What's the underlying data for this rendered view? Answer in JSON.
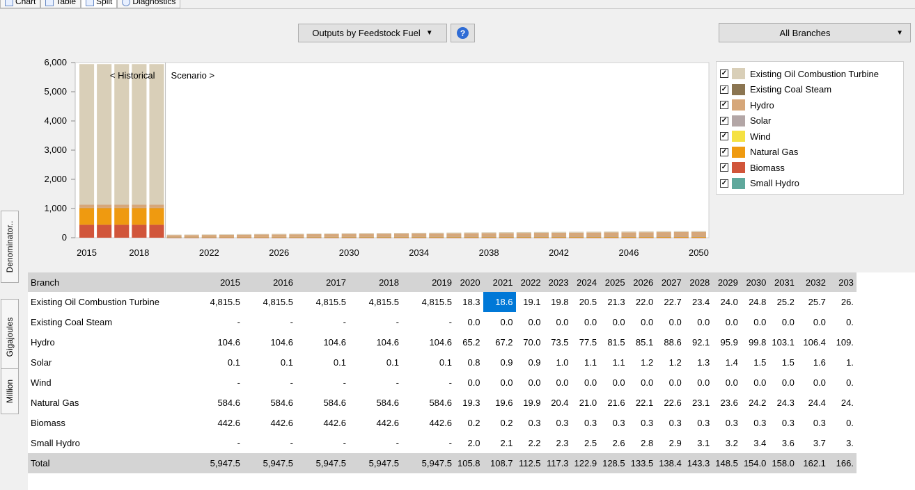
{
  "tabs": [
    {
      "label": "Chart",
      "active": false
    },
    {
      "label": "Table",
      "active": false
    },
    {
      "label": "Split",
      "active": true
    },
    {
      "label": "Diagnostics",
      "active": false
    }
  ],
  "toolbar": {
    "outputs_selector": "Outputs by Feedstock Fuel",
    "branches_selector": "All Branches"
  },
  "side_tabs": [
    "Denominator..",
    "Gigajoules",
    "Million"
  ],
  "legend": [
    {
      "label": "Existing Oil Combustion Turbine",
      "color": "#d9cfb8",
      "checked": true
    },
    {
      "label": "Existing Coal Steam",
      "color": "#8b7551",
      "checked": true
    },
    {
      "label": "Hydro",
      "color": "#d6a77a",
      "checked": true
    },
    {
      "label": "Solar",
      "color": "#b3a6a6",
      "checked": true
    },
    {
      "label": "Wind",
      "color": "#f5e142",
      "checked": true
    },
    {
      "label": "Natural Gas",
      "color": "#ef9a10",
      "checked": true
    },
    {
      "label": "Biomass",
      "color": "#d1553a",
      "checked": true
    },
    {
      "label": "Small Hydro",
      "color": "#5fa89c",
      "checked": true
    }
  ],
  "chart_data": {
    "type": "bar",
    "stacked": true,
    "x": [
      2015,
      2016,
      2017,
      2018,
      2019,
      2020,
      2021,
      2022,
      2023,
      2024,
      2025,
      2026,
      2027,
      2028,
      2029,
      2030,
      2031,
      2032,
      2033,
      2034,
      2035,
      2036,
      2037,
      2038,
      2039,
      2040,
      2041,
      2042,
      2043,
      2044,
      2045,
      2046,
      2047,
      2048,
      2049,
      2050
    ],
    "x_ticks": [
      "2015",
      "2018",
      "2022",
      "2026",
      "2030",
      "2034",
      "2038",
      "2042",
      "2046",
      "2050"
    ],
    "y_ticks": [
      "6,000",
      "5,000",
      "4,000",
      "3,000",
      "2,000",
      "1,000",
      "0"
    ],
    "ylim": [
      0,
      6000
    ],
    "annotations": [
      "< Historical",
      "Scenario >"
    ],
    "series": [
      {
        "name": "Biomass",
        "color": "#d1553a",
        "values": [
          442.6,
          442.6,
          442.6,
          442.6,
          442.6,
          0.2,
          0.2,
          0.3,
          0.3,
          0.3,
          0.3,
          0.3,
          0.3,
          0.3,
          0.3,
          0.3,
          0.3,
          0.3,
          0.3,
          0.3,
          0.3,
          0.3,
          0.3,
          0.3,
          0.3,
          0.3,
          0.3,
          0.3,
          0.3,
          0.3,
          0.3,
          0.3,
          0.3,
          0.3,
          0.3,
          0.3
        ]
      },
      {
        "name": "Natural Gas",
        "color": "#ef9a10",
        "values": [
          584.6,
          584.6,
          584.6,
          584.6,
          584.6,
          19.3,
          19.6,
          19.9,
          20.4,
          21.0,
          21.6,
          22.1,
          22.6,
          23.1,
          23.6,
          24.2,
          24.3,
          24.4,
          24.5,
          24.6,
          24.7,
          24.8,
          24.9,
          25.0,
          25.1,
          25.2,
          25.3,
          25.4,
          25.5,
          25.6,
          25.7,
          25.8,
          25.9,
          26.0,
          26.1,
          26.2
        ]
      },
      {
        "name": "Small Hydro",
        "color": "#5fa89c",
        "values": [
          0,
          0,
          0,
          0,
          0,
          2.0,
          2.1,
          2.2,
          2.3,
          2.5,
          2.6,
          2.8,
          2.9,
          3.1,
          3.2,
          3.4,
          3.6,
          3.7,
          3.9,
          4.0,
          4.2,
          4.3,
          4.5,
          4.6,
          4.8,
          4.9,
          5.1,
          5.2,
          5.4,
          5.5,
          5.7,
          5.8,
          6.0,
          6.1,
          6.3,
          6.4
        ]
      },
      {
        "name": "Solar",
        "color": "#b3a6a6",
        "values": [
          0.1,
          0.1,
          0.1,
          0.1,
          0.1,
          0.8,
          0.9,
          0.9,
          1.0,
          1.1,
          1.1,
          1.2,
          1.2,
          1.3,
          1.4,
          1.5,
          1.5,
          1.6,
          1.7,
          1.7,
          1.8,
          1.9,
          2.0,
          2.0,
          2.1,
          2.2,
          2.3,
          2.3,
          2.4,
          2.5,
          2.6,
          2.6,
          2.7,
          2.8,
          2.9,
          3.0
        ]
      },
      {
        "name": "Hydro",
        "color": "#d6a77a",
        "values": [
          104.6,
          104.6,
          104.6,
          104.6,
          104.6,
          65.2,
          67.2,
          70.0,
          73.5,
          77.5,
          81.5,
          85.1,
          88.6,
          92.1,
          95.9,
          99.8,
          103.1,
          106.4,
          109.5,
          112,
          115,
          118,
          121,
          124,
          127,
          130,
          133,
          136,
          139,
          142,
          145,
          148,
          151,
          154,
          157,
          160
        ]
      },
      {
        "name": "Existing Coal Steam",
        "color": "#8b7551",
        "values": [
          0,
          0,
          0,
          0,
          0,
          0,
          0,
          0,
          0,
          0,
          0,
          0,
          0,
          0,
          0,
          0,
          0,
          0,
          0,
          0,
          0,
          0,
          0,
          0,
          0,
          0,
          0,
          0,
          0,
          0,
          0,
          0,
          0,
          0,
          0,
          0
        ]
      },
      {
        "name": "Wind",
        "color": "#f5e142",
        "values": [
          0,
          0,
          0,
          0,
          0,
          0,
          0,
          0,
          0,
          0,
          0,
          0,
          0,
          0,
          0,
          0,
          0,
          0,
          0,
          0,
          0,
          0,
          0,
          0,
          0,
          0,
          0,
          0,
          0,
          0,
          0,
          0,
          0,
          0,
          0,
          0
        ]
      },
      {
        "name": "Existing Oil Combustion Turbine",
        "color": "#d9cfb8",
        "values": [
          4815.5,
          4815.5,
          4815.5,
          4815.5,
          4815.5,
          18.3,
          18.6,
          19.1,
          19.8,
          20.5,
          21.3,
          22.0,
          22.7,
          23.4,
          24.0,
          24.8,
          25.2,
          25.7,
          26.2,
          26.7,
          27.2,
          27.7,
          28.2,
          28.7,
          29.2,
          29.7,
          30.2,
          30.7,
          31.2,
          31.7,
          32.2,
          32.7,
          33.2,
          33.7,
          34.2,
          34.7
        ]
      }
    ]
  },
  "table": {
    "header_label": "Branch",
    "years": [
      "2015",
      "2016",
      "2017",
      "2018",
      "2019",
      "2020",
      "2021",
      "2022",
      "2023",
      "2024",
      "2025",
      "2026",
      "2027",
      "2028",
      "2029",
      "2030",
      "2031",
      "2032",
      "203"
    ],
    "rows": [
      {
        "name": "Existing Oil Combustion Turbine",
        "values": [
          "4,815.5",
          "4,815.5",
          "4,815.5",
          "4,815.5",
          "4,815.5",
          "18.3",
          "18.6",
          "19.1",
          "19.8",
          "20.5",
          "21.3",
          "22.0",
          "22.7",
          "23.4",
          "24.0",
          "24.8",
          "25.2",
          "25.7",
          "26."
        ]
      },
      {
        "name": "Existing Coal Steam",
        "values": [
          "-",
          "-",
          "-",
          "-",
          "-",
          "0.0",
          "0.0",
          "0.0",
          "0.0",
          "0.0",
          "0.0",
          "0.0",
          "0.0",
          "0.0",
          "0.0",
          "0.0",
          "0.0",
          "0.0",
          "0."
        ]
      },
      {
        "name": "Hydro",
        "values": [
          "104.6",
          "104.6",
          "104.6",
          "104.6",
          "104.6",
          "65.2",
          "67.2",
          "70.0",
          "73.5",
          "77.5",
          "81.5",
          "85.1",
          "88.6",
          "92.1",
          "95.9",
          "99.8",
          "103.1",
          "106.4",
          "109."
        ]
      },
      {
        "name": "Solar",
        "values": [
          "0.1",
          "0.1",
          "0.1",
          "0.1",
          "0.1",
          "0.8",
          "0.9",
          "0.9",
          "1.0",
          "1.1",
          "1.1",
          "1.2",
          "1.2",
          "1.3",
          "1.4",
          "1.5",
          "1.5",
          "1.6",
          "1."
        ]
      },
      {
        "name": "Wind",
        "values": [
          "-",
          "-",
          "-",
          "-",
          "-",
          "0.0",
          "0.0",
          "0.0",
          "0.0",
          "0.0",
          "0.0",
          "0.0",
          "0.0",
          "0.0",
          "0.0",
          "0.0",
          "0.0",
          "0.0",
          "0."
        ]
      },
      {
        "name": "Natural Gas",
        "values": [
          "584.6",
          "584.6",
          "584.6",
          "584.6",
          "584.6",
          "19.3",
          "19.6",
          "19.9",
          "20.4",
          "21.0",
          "21.6",
          "22.1",
          "22.6",
          "23.1",
          "23.6",
          "24.2",
          "24.3",
          "24.4",
          "24."
        ]
      },
      {
        "name": "Biomass",
        "values": [
          "442.6",
          "442.6",
          "442.6",
          "442.6",
          "442.6",
          "0.2",
          "0.2",
          "0.3",
          "0.3",
          "0.3",
          "0.3",
          "0.3",
          "0.3",
          "0.3",
          "0.3",
          "0.3",
          "0.3",
          "0.3",
          "0."
        ]
      },
      {
        "name": "Small Hydro",
        "values": [
          "-",
          "-",
          "-",
          "-",
          "-",
          "2.0",
          "2.1",
          "2.2",
          "2.3",
          "2.5",
          "2.6",
          "2.8",
          "2.9",
          "3.1",
          "3.2",
          "3.4",
          "3.6",
          "3.7",
          "3."
        ]
      }
    ],
    "total": {
      "name": "Total",
      "values": [
        "5,947.5",
        "5,947.5",
        "5,947.5",
        "5,947.5",
        "5,947.5",
        "105.8",
        "108.7",
        "112.5",
        "117.3",
        "122.9",
        "128.5",
        "133.5",
        "138.4",
        "143.3",
        "148.5",
        "154.0",
        "158.0",
        "162.1",
        "166."
      ]
    },
    "selected_cell": {
      "row": 0,
      "col": 6
    }
  }
}
